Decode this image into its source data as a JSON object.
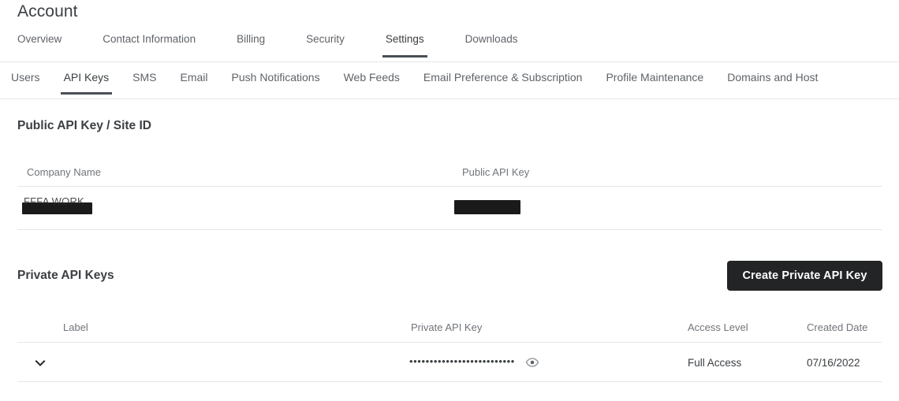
{
  "page": {
    "title": "Account"
  },
  "primary_nav": {
    "items": [
      {
        "label": "Overview",
        "active": false
      },
      {
        "label": "Contact Information",
        "active": false
      },
      {
        "label": "Billing",
        "active": false
      },
      {
        "label": "Security",
        "active": false
      },
      {
        "label": "Settings",
        "active": true
      },
      {
        "label": "Downloads",
        "active": false
      }
    ]
  },
  "secondary_nav": {
    "items": [
      {
        "label": "Users",
        "active": false
      },
      {
        "label": "API Keys",
        "active": true
      },
      {
        "label": "SMS",
        "active": false
      },
      {
        "label": "Email",
        "active": false
      },
      {
        "label": "Push Notifications",
        "active": false
      },
      {
        "label": "Web Feeds",
        "active": false
      },
      {
        "label": "Email Preference & Subscription",
        "active": false
      },
      {
        "label": "Profile Maintenance",
        "active": false
      },
      {
        "label": "Domains and Host",
        "active": false
      }
    ]
  },
  "public_section": {
    "title": "Public API Key / Site ID",
    "columns": {
      "company_name": "Company Name",
      "public_api_key": "Public API Key"
    },
    "row": {
      "company_name_redacted_hint": "FFFA WORK",
      "public_api_key_redacted_hint": ""
    }
  },
  "private_section": {
    "title": "Private API Keys",
    "create_button": "Create Private API Key",
    "columns": {
      "label": "Label",
      "private_api_key": "Private API Key",
      "access_level": "Access Level",
      "created_date": "Created Date"
    },
    "row": {
      "label": "",
      "masked_key": "••••••••••••••••••••••••••",
      "access_level": "Full Access",
      "created_date": "07/16/2022"
    }
  },
  "icons": {
    "expand": "chevron-down-icon",
    "reveal": "eye-icon"
  },
  "colors": {
    "accent_underline": "#4a5057",
    "button_background": "#222426",
    "divider": "#e4e6e8",
    "muted_text": "#70757a",
    "primary_text": "#3c4043"
  }
}
